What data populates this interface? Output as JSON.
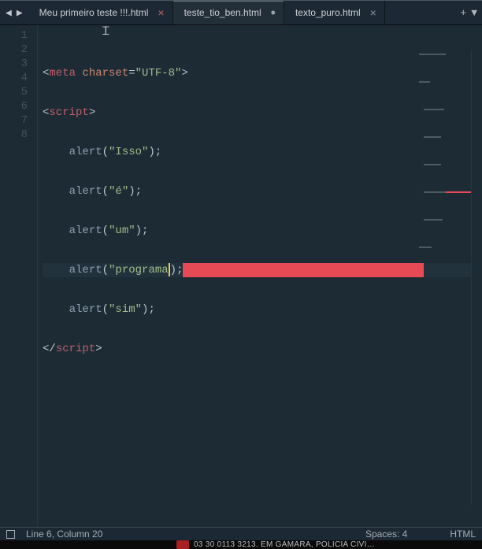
{
  "tabs": {
    "t1": {
      "label": "Meu primeiro teste !!!.html"
    },
    "t2": {
      "label": "teste_tio_ben.html"
    },
    "t3": {
      "label": "texto_puro.html"
    }
  },
  "gutter": {
    "l1": "1",
    "l2": "2",
    "l3": "3",
    "l4": "4",
    "l5": "5",
    "l6": "6",
    "l7": "7",
    "l8": "8"
  },
  "code": {
    "meta": "meta",
    "charset": "charset",
    "charset_eq": "=",
    "utf8": "\"UTF-8\"",
    "script": "script",
    "alert": "alert",
    "str_isso": "\"Isso\"",
    "str_e": "\"é\"",
    "str_um": "\"um\"",
    "str_programa": "\"programa",
    "str_sim": "\"sim\"",
    "lt": "<",
    "gt": ">",
    "ltsl": "</",
    "op": "(",
    "cp": ")",
    "sc": ";",
    "sp": " "
  },
  "status": {
    "position": "Line 6, Column 20",
    "spaces": "Spaces: 4",
    "lang": "HTML"
  },
  "strip": {
    "text": "03 30 0113 3213. EM GAMARA, POLICIA CIVI…"
  }
}
